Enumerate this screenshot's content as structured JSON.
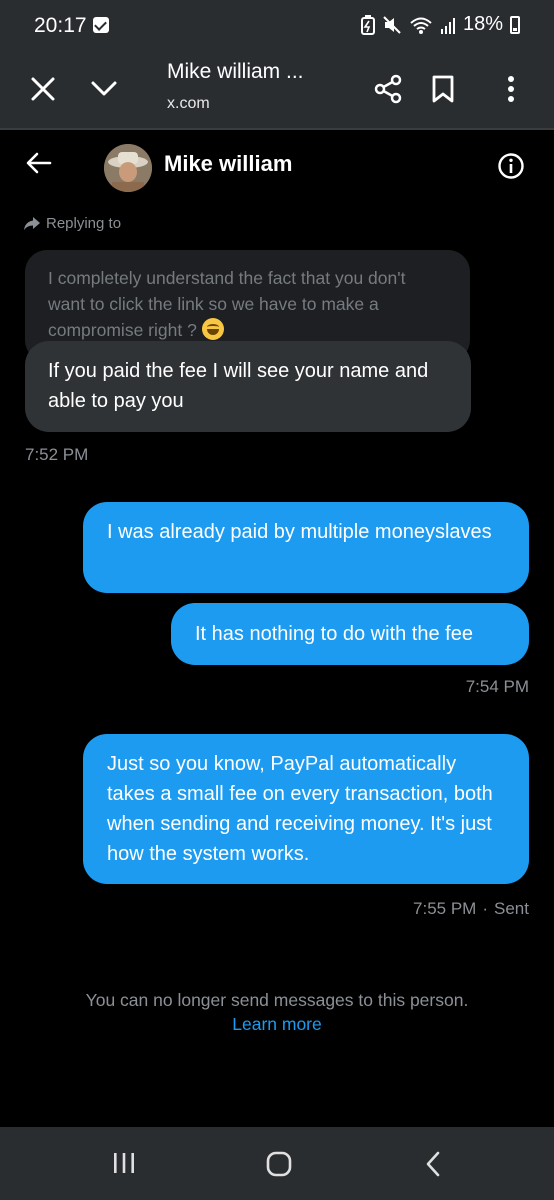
{
  "status_bar": {
    "time": "20:17",
    "battery": "18%"
  },
  "browser": {
    "title": "Mike william ...",
    "url": "x.com"
  },
  "conversation": {
    "name": "Mike william",
    "replying_label": "Replying to",
    "quoted_message": "I completely understand the fact that you don't want to click the link so we have to make a compromise right ?",
    "messages": [
      {
        "direction": "in",
        "text": "If you paid the fee I will see your name and able to pay you"
      },
      {
        "direction": "out",
        "text": "I was already paid by multiple moneyslaves"
      },
      {
        "direction": "out",
        "text": "It has nothing to do with the fee"
      },
      {
        "direction": "out",
        "text": "Just so you know, PayPal automatically takes a small fee on every transaction, both when sending and receiving money. It's just how the system works."
      }
    ],
    "timestamps": [
      "7:52 PM",
      "7:54 PM",
      "7:55 PM"
    ],
    "sent_label": "Sent",
    "separator": "·"
  },
  "footer": {
    "notice": "You can no longer send messages to this person.",
    "learn_more": "Learn more"
  },
  "colors": {
    "accent": "#1d9bf0",
    "incoming_bubble": "#303336",
    "background": "#000000"
  },
  "icons": [
    "close-icon",
    "chevron-down-icon",
    "share-icon",
    "bookmark-icon",
    "more-vert-icon",
    "back-arrow-icon",
    "info-icon",
    "reply-arrow-icon",
    "recents-icon",
    "home-icon",
    "nav-back-icon"
  ]
}
